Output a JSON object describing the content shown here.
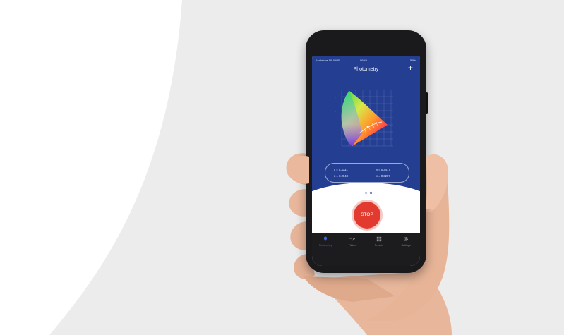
{
  "app": {
    "status_bar": {
      "carrier": "Vodafone NL Wi-Fi",
      "time": "09:45",
      "battery": "59%"
    },
    "title": "Photometry",
    "add_icon": "plus-icon",
    "readings": {
      "x": "x = 0.3331",
      "y": "y = 0.3477",
      "u": "u = 0.2048",
      "v": "v = 0.3207"
    },
    "pager": {
      "count": 2,
      "active": 1
    },
    "stop_label": "STOP",
    "tabs": [
      {
        "label": "Photometry",
        "icon": "lightbulb-icon",
        "active": true
      },
      {
        "label": "Flicker",
        "icon": "wave-icon",
        "active": false
      },
      {
        "label": "Presets",
        "icon": "grid-icon",
        "active": false
      },
      {
        "label": "Settings",
        "icon": "gear-icon",
        "active": false
      }
    ]
  },
  "colors": {
    "brand_blue": "#243f92",
    "stop_red": "#e23a2e",
    "tab_active": "#3d68d8",
    "tabbar_bg": "#1c1c1e"
  }
}
